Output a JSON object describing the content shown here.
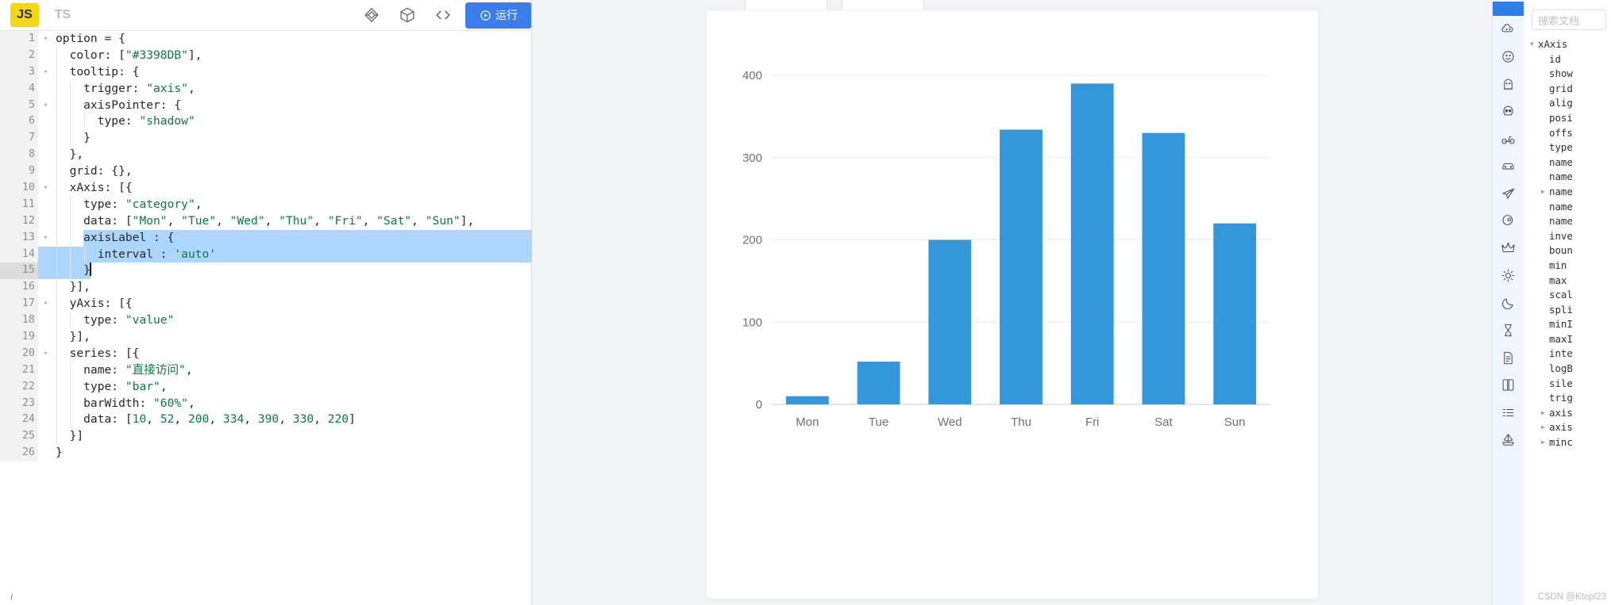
{
  "editor": {
    "tabs": [
      {
        "label": "JS",
        "active": true
      },
      {
        "label": "TS",
        "active": false
      }
    ],
    "toolbar_icons": [
      {
        "name": "diamond-cube-icon"
      },
      {
        "name": "cube-icon"
      },
      {
        "name": "code-brackets-icon"
      }
    ],
    "run_button": "运行",
    "status_hint": "i",
    "lines": [
      {
        "n": 1,
        "fold": true,
        "text": "option = {",
        "indent": 0
      },
      {
        "n": 2,
        "fold": false,
        "text": "  color: [\"#3398DB\"],",
        "indent": 1
      },
      {
        "n": 3,
        "fold": true,
        "text": "  tooltip: {",
        "indent": 1
      },
      {
        "n": 4,
        "fold": false,
        "text": "    trigger: \"axis\",",
        "indent": 2
      },
      {
        "n": 5,
        "fold": true,
        "text": "    axisPointer: {",
        "indent": 2
      },
      {
        "n": 6,
        "fold": false,
        "text": "      type: \"shadow\"",
        "indent": 3
      },
      {
        "n": 7,
        "fold": false,
        "text": "    }",
        "indent": 2
      },
      {
        "n": 8,
        "fold": false,
        "text": "  },",
        "indent": 1
      },
      {
        "n": 9,
        "fold": false,
        "text": "  grid: {},",
        "indent": 1
      },
      {
        "n": 10,
        "fold": true,
        "text": "  xAxis: [{",
        "indent": 1
      },
      {
        "n": 11,
        "fold": false,
        "text": "    type: \"category\",",
        "indent": 2
      },
      {
        "n": 12,
        "fold": false,
        "text": "    data: [\"Mon\", \"Tue\", \"Wed\", \"Thu\", \"Fri\", \"Sat\", \"Sun\"],",
        "indent": 2
      },
      {
        "n": 13,
        "fold": true,
        "text": "    axisLabel : {",
        "indent": 2
      },
      {
        "n": 14,
        "fold": false,
        "text": "      interval : 'auto'",
        "indent": 3
      },
      {
        "n": 15,
        "fold": false,
        "text": "    }",
        "indent": 2
      },
      {
        "n": 16,
        "fold": false,
        "text": "  }],",
        "indent": 1
      },
      {
        "n": 17,
        "fold": true,
        "text": "  yAxis: [{",
        "indent": 1
      },
      {
        "n": 18,
        "fold": false,
        "text": "    type: \"value\"",
        "indent": 2
      },
      {
        "n": 19,
        "fold": false,
        "text": "  }],",
        "indent": 1
      },
      {
        "n": 20,
        "fold": true,
        "text": "  series: [{",
        "indent": 1
      },
      {
        "n": 21,
        "fold": false,
        "text": "    name: \"直接访问\",",
        "indent": 2
      },
      {
        "n": 22,
        "fold": false,
        "text": "    type: \"bar\",",
        "indent": 2
      },
      {
        "n": 23,
        "fold": false,
        "text": "    barWidth: \"60%\",",
        "indent": 2
      },
      {
        "n": 24,
        "fold": false,
        "text": "    data: [10, 52, 200, 334, 390, 330, 220]",
        "indent": 2
      },
      {
        "n": 25,
        "fold": false,
        "text": "  }]",
        "indent": 1
      },
      {
        "n": 26,
        "fold": false,
        "text": "}",
        "indent": 0
      }
    ],
    "selection": {
      "start_line": 13,
      "end_line": 15,
      "active_line": 15
    }
  },
  "chart_data": {
    "type": "bar",
    "title": "",
    "categories": [
      "Mon",
      "Tue",
      "Wed",
      "Thu",
      "Fri",
      "Sat",
      "Sun"
    ],
    "series": [
      {
        "name": "直接访问",
        "values": [
          10,
          52,
          200,
          334,
          390,
          330,
          220
        ],
        "color": "#3398DB"
      }
    ],
    "xlabel": "",
    "ylabel": "",
    "ylim": [
      0,
      400
    ],
    "yticks": [
      0,
      100,
      200,
      300,
      400
    ],
    "ytick_labels": [
      "0",
      "100",
      "200",
      "300",
      "400"
    ],
    "grid": true,
    "legend": "none",
    "bar_width_pct": "60%"
  },
  "right_panel": {
    "rail_icons": [
      {
        "name": "cloud-smile-icon",
        "glyph": "cloud-smile"
      },
      {
        "name": "face-smile-icon",
        "glyph": "face"
      },
      {
        "name": "ghost-icon",
        "glyph": "ghost"
      },
      {
        "name": "skull-icon",
        "glyph": "skull"
      },
      {
        "name": "bicycle-icon",
        "glyph": "bike"
      },
      {
        "name": "car-icon",
        "glyph": "car"
      },
      {
        "name": "airplane-icon",
        "glyph": "plane"
      },
      {
        "name": "rocket-icon",
        "glyph": "rocket"
      },
      {
        "name": "crown-icon",
        "glyph": "crown"
      },
      {
        "name": "sun-icon",
        "glyph": "sun"
      },
      {
        "name": "moon-icon",
        "glyph": "moon"
      },
      {
        "name": "hourglass-icon",
        "glyph": "hourglass"
      },
      {
        "name": "document-icon",
        "glyph": "doc"
      },
      {
        "name": "book-icon",
        "glyph": "book"
      },
      {
        "name": "list-icon",
        "glyph": "list"
      },
      {
        "name": "boat-icon",
        "glyph": "boat"
      }
    ],
    "search_placeholder": "搜索文档",
    "tree": [
      {
        "label": "xAxis",
        "level": 1,
        "expandable": true,
        "expanded": true
      },
      {
        "label": "id",
        "level": 2,
        "expandable": false
      },
      {
        "label": "show",
        "level": 2,
        "expandable": false
      },
      {
        "label": "grid",
        "level": 2,
        "expandable": false
      },
      {
        "label": "alig",
        "level": 2,
        "expandable": false
      },
      {
        "label": "posi",
        "level": 2,
        "expandable": false
      },
      {
        "label": "offs",
        "level": 2,
        "expandable": false
      },
      {
        "label": "type",
        "level": 2,
        "expandable": false
      },
      {
        "label": "name",
        "level": 2,
        "expandable": false
      },
      {
        "label": "name",
        "level": 2,
        "expandable": false
      },
      {
        "label": "name",
        "level": 2,
        "expandable": true
      },
      {
        "label": "name",
        "level": 2,
        "expandable": false
      },
      {
        "label": "name",
        "level": 2,
        "expandable": false
      },
      {
        "label": "inve",
        "level": 2,
        "expandable": false
      },
      {
        "label": "boun",
        "level": 2,
        "expandable": false
      },
      {
        "label": "min",
        "level": 2,
        "expandable": false
      },
      {
        "label": "max",
        "level": 2,
        "expandable": false
      },
      {
        "label": "scal",
        "level": 2,
        "expandable": false
      },
      {
        "label": "spli",
        "level": 2,
        "expandable": false
      },
      {
        "label": "minI",
        "level": 2,
        "expandable": false
      },
      {
        "label": "maxI",
        "level": 2,
        "expandable": false
      },
      {
        "label": "inte",
        "level": 2,
        "expandable": false
      },
      {
        "label": "logB",
        "level": 2,
        "expandable": false
      },
      {
        "label": "sile",
        "level": 2,
        "expandable": false
      },
      {
        "label": "trig",
        "level": 2,
        "expandable": false
      },
      {
        "label": "axis",
        "level": 2,
        "expandable": true
      },
      {
        "label": "axis",
        "level": 2,
        "expandable": true
      },
      {
        "label": "minc",
        "level": 2,
        "expandable": true
      }
    ],
    "watermark": "CSDN @Ktopl23"
  },
  "colors": {
    "bar": "#3398DB",
    "accent": "#3b7ded",
    "selection": "#add6ff",
    "gutter_bg": "#f2f2f2",
    "chart_bg": "#f2f3f5",
    "rail_bg": "#f0f6fd"
  }
}
